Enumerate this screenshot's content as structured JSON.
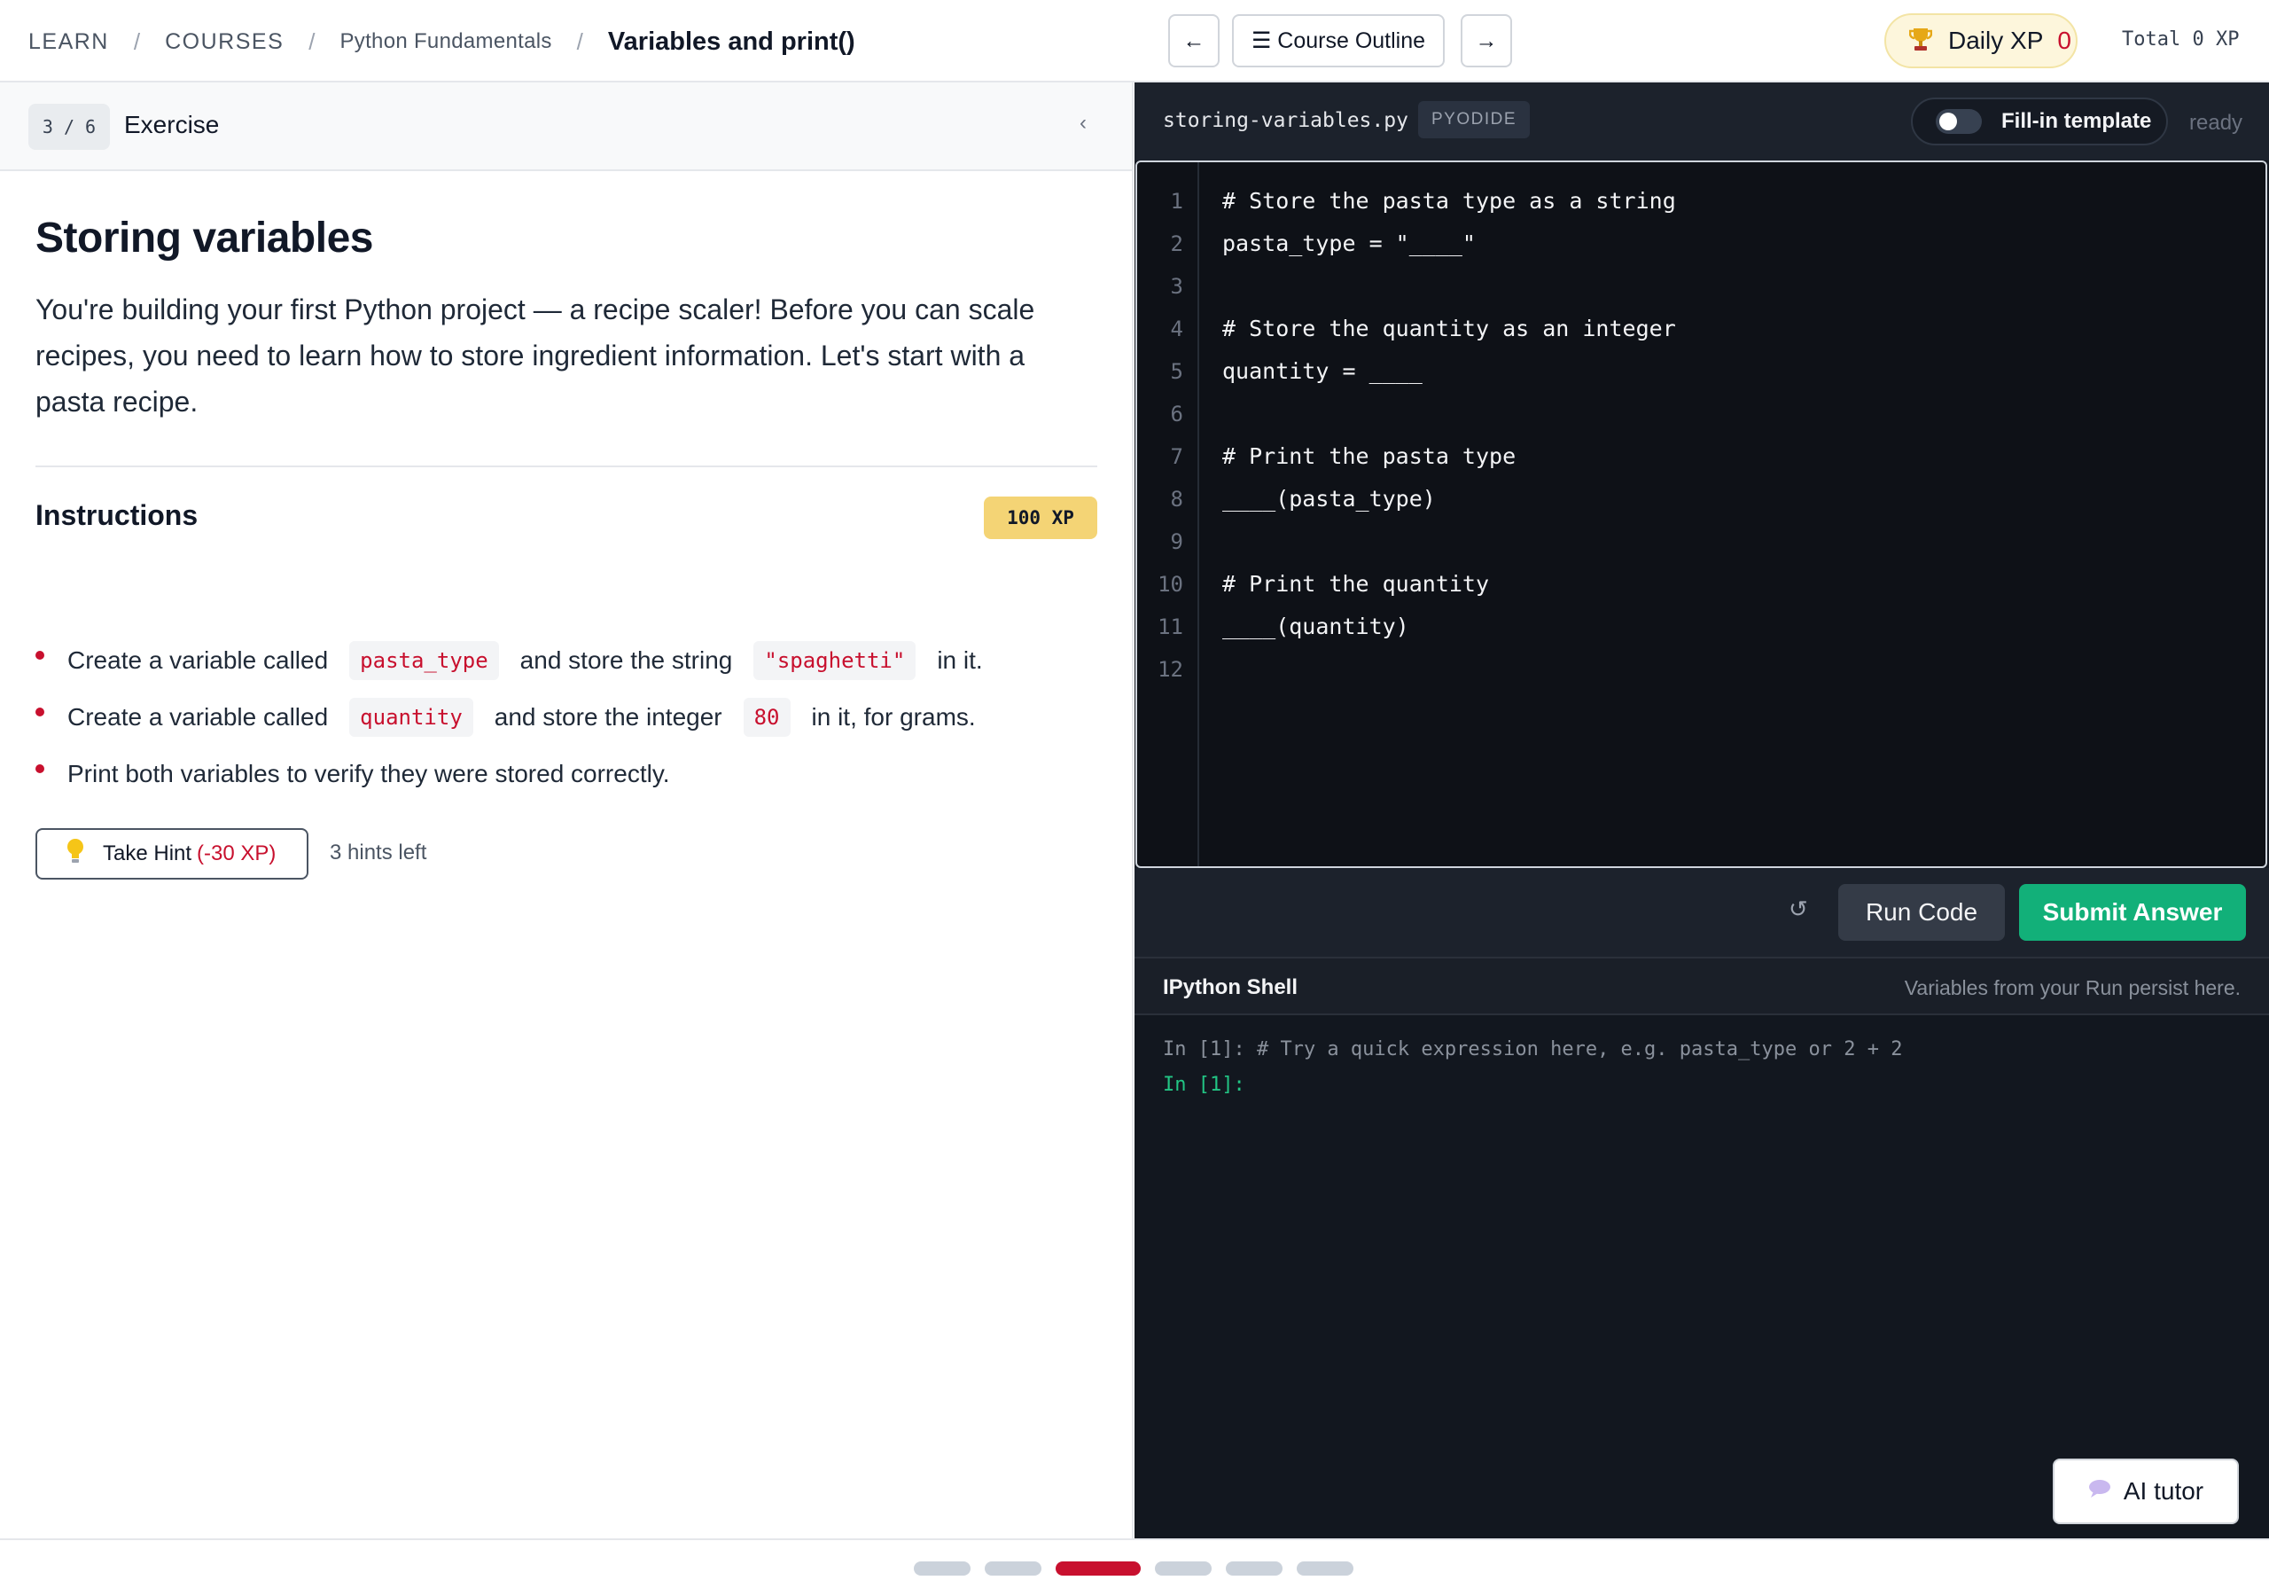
{
  "breadcrumb": {
    "items": [
      "LEARN",
      "COURSES",
      "Python Fundamentals"
    ],
    "current": "Variables and print()",
    "separator": "/"
  },
  "nav": {
    "prev_icon": "←",
    "outline_label": "☰ Course Outline",
    "next_icon": "→"
  },
  "xp": {
    "daily_label": "Daily XP",
    "daily_value": "0",
    "total": "Total 0 XP",
    "trophy_icon": "trophy-icon"
  },
  "exercise": {
    "step": "3 / 6",
    "label": "Exercise",
    "collapse_icon": "‹",
    "title": "Storing variables",
    "description": "You're building your first Python project — a recipe scaler! Before you can scale recipes, you need to learn how to store ingredient information. Let's start with a pasta recipe.",
    "instructions_title": "Instructions",
    "xp_badge": "100 XP",
    "instructions": [
      {
        "pre": "Create a variable called",
        "code1": "pasta_type",
        "mid": "and store the string",
        "code2": "\"spaghetti\"",
        "post": "in it."
      },
      {
        "pre": "Create a variable called",
        "code1": "quantity",
        "mid": "and store the integer",
        "code2": "80",
        "post": "in it, for grams."
      },
      {
        "pre": "Print both variables to verify they were stored correctly."
      }
    ],
    "hint_label": "Take Hint",
    "hint_penalty": "(-30 XP)",
    "hints_left": "3 hints left"
  },
  "editor": {
    "filename": "storing-variables.py",
    "runtime": "PYODIDE",
    "toggle_label": "Fill-in template",
    "toggle_on": false,
    "status": "ready",
    "line_numbers": [
      "1",
      "2",
      "3",
      "4",
      "5",
      "6",
      "7",
      "8",
      "9",
      "10",
      "11",
      "12"
    ],
    "lines": [
      "# Store the pasta type as a string",
      "pasta_type = \"____\"",
      "",
      "# Store the quantity as an integer",
      "quantity = ____",
      "",
      "# Print the pasta type",
      "____(pasta_type)",
      "",
      "# Print the quantity",
      "____(quantity)",
      ""
    ]
  },
  "actions": {
    "reset_icon": "↺",
    "run_label": "Run Code",
    "submit_label": "Submit Answer"
  },
  "shell": {
    "title": "IPython Shell",
    "note": "Variables from your Run persist here.",
    "history": "In [1]: # Try a quick expression here, e.g. pasta_type or 2 + 2",
    "prompt": "In [1]:"
  },
  "ai_tutor": {
    "label": "AI tutor",
    "icon": "speech-bubble-icon"
  },
  "progress": {
    "total": 6,
    "current": 3
  },
  "colors": {
    "accent": "#c8102e",
    "submit": "#12b079",
    "xp_badge": "#f4d475",
    "editor_bg": "#0e1117",
    "shell_prompt": "#22c584"
  }
}
